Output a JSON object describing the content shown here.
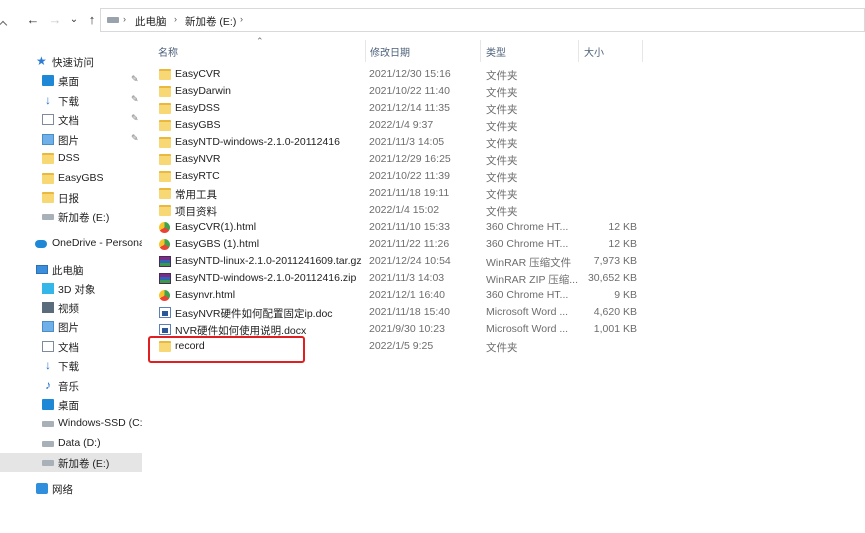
{
  "address": {
    "crumbs": [
      "此电脑",
      "新加卷 (E:)"
    ]
  },
  "nav_icons": {
    "back": "←",
    "forward": "→",
    "recent": "⌄",
    "up": "↑",
    "separator": "›"
  },
  "sidebar": {
    "quick_access": "快速访问",
    "items": [
      {
        "label": "桌面",
        "icon": "desktop-icon",
        "pinned": true
      },
      {
        "label": "下载",
        "icon": "download-icon",
        "pinned": true
      },
      {
        "label": "文档",
        "icon": "document-icon",
        "pinned": true
      },
      {
        "label": "图片",
        "icon": "picture-icon",
        "pinned": true
      },
      {
        "label": "DSS",
        "icon": "folder-icon",
        "pinned": false
      },
      {
        "label": "EasyGBS",
        "icon": "folder-icon",
        "pinned": false
      },
      {
        "label": "日报",
        "icon": "folder-icon",
        "pinned": false
      },
      {
        "label": "新加卷 (E:)",
        "icon": "drive-icon",
        "pinned": false
      }
    ],
    "onedrive": "OneDrive - Persona",
    "this_pc": "此电脑",
    "pc_items": [
      {
        "label": "3D 对象",
        "icon": "3d-objects-icon"
      },
      {
        "label": "视频",
        "icon": "video-icon"
      },
      {
        "label": "图片",
        "icon": "picture-icon"
      },
      {
        "label": "文档",
        "icon": "document-icon"
      },
      {
        "label": "下载",
        "icon": "download-icon"
      },
      {
        "label": "音乐",
        "icon": "music-icon"
      },
      {
        "label": "桌面",
        "icon": "desktop-icon"
      },
      {
        "label": "Windows-SSD (C:)",
        "icon": "drive-icon"
      },
      {
        "label": "Data (D:)",
        "icon": "drive-icon"
      },
      {
        "label": "新加卷 (E:)",
        "icon": "drive-icon",
        "selected": true
      }
    ],
    "network": "网络"
  },
  "columns": {
    "name": "名称",
    "date": "修改日期",
    "type": "类型",
    "size": "大小"
  },
  "files": [
    {
      "name": "EasyCVR",
      "date": "2021/12/30 15:16",
      "type": "文件夹",
      "size": "",
      "kind": "folder"
    },
    {
      "name": "EasyDarwin",
      "date": "2021/10/22 11:40",
      "type": "文件夹",
      "size": "",
      "kind": "folder"
    },
    {
      "name": "EasyDSS",
      "date": "2021/12/14 11:35",
      "type": "文件夹",
      "size": "",
      "kind": "folder"
    },
    {
      "name": "EasyGBS",
      "date": "2022/1/4 9:37",
      "type": "文件夹",
      "size": "",
      "kind": "folder"
    },
    {
      "name": "EasyNTD-windows-2.1.0-20112416",
      "date": "2021/11/3 14:05",
      "type": "文件夹",
      "size": "",
      "kind": "folder"
    },
    {
      "name": "EasyNVR",
      "date": "2021/12/29 16:25",
      "type": "文件夹",
      "size": "",
      "kind": "folder"
    },
    {
      "name": "EasyRTC",
      "date": "2021/10/22 11:39",
      "type": "文件夹",
      "size": "",
      "kind": "folder"
    },
    {
      "name": "常用工具",
      "date": "2021/11/18 19:11",
      "type": "文件夹",
      "size": "",
      "kind": "folder"
    },
    {
      "name": "项目资料",
      "date": "2022/1/4 15:02",
      "type": "文件夹",
      "size": "",
      "kind": "folder"
    },
    {
      "name": "EasyCVR(1).html",
      "date": "2021/11/10 15:33",
      "type": "360 Chrome HT...",
      "size": "12 KB",
      "kind": "html"
    },
    {
      "name": "EasyGBS (1).html",
      "date": "2021/11/22 11:26",
      "type": "360 Chrome HT...",
      "size": "12 KB",
      "kind": "html"
    },
    {
      "name": "EasyNTD-linux-2.1.0-2011241609.tar.gz",
      "date": "2021/12/24 10:54",
      "type": "WinRAR 压缩文件",
      "size": "7,973 KB",
      "kind": "rar"
    },
    {
      "name": "EasyNTD-windows-2.1.0-20112416.zip",
      "date": "2021/11/3 14:03",
      "type": "WinRAR ZIP 压缩...",
      "size": "30,652 KB",
      "kind": "rar"
    },
    {
      "name": "Easynvr.html",
      "date": "2021/12/1 16:40",
      "type": "360 Chrome HT...",
      "size": "9 KB",
      "kind": "html"
    },
    {
      "name": "EasyNVR硬件如何配置固定ip.doc",
      "date": "2021/11/18 15:40",
      "type": "Microsoft Word ...",
      "size": "4,620 KB",
      "kind": "word"
    },
    {
      "name": "NVR硬件如何使用说明.docx",
      "date": "2021/9/30 10:23",
      "type": "Microsoft Word ...",
      "size": "1,001 KB",
      "kind": "word"
    },
    {
      "name": "record",
      "date": "2022/1/5 9:25",
      "type": "文件夹",
      "size": "",
      "kind": "folder"
    }
  ],
  "colors": {
    "highlight_border": "#e02020",
    "selected_bg": "#e5e5e5",
    "folder": "#f8d775"
  }
}
